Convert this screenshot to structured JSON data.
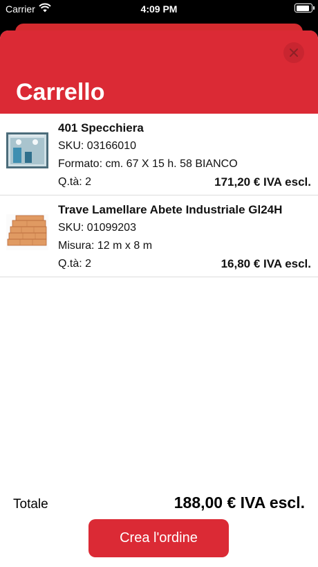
{
  "status_bar": {
    "carrier": "Carrier",
    "time": "4:09 PM",
    "battery_level": 0.9
  },
  "header": {
    "title": "Carrello",
    "close_icon": "close-icon",
    "color": "#db2a35"
  },
  "cart": {
    "items": [
      {
        "name": "401 Specchiera",
        "sku": "SKU: 03166010",
        "variant": "Formato: cm. 67 X 15 h. 58 BIANCO",
        "quantity": "Q.tà: 2",
        "price": "171,20 € IVA escl.",
        "image": "mirror-image"
      },
      {
        "name": "Trave Lamellare Abete Industriale Gl24H",
        "sku": "SKU: 01099203",
        "variant": "Misura: 12 m x 8 m",
        "quantity": "Q.tà: 2",
        "price": "16,80 € IVA escl.",
        "image": "wood-beams-image"
      }
    ]
  },
  "footer": {
    "total_label": "Totale",
    "total_value": "188,00 € IVA escl.",
    "order_button_label": "Crea l'ordine"
  }
}
